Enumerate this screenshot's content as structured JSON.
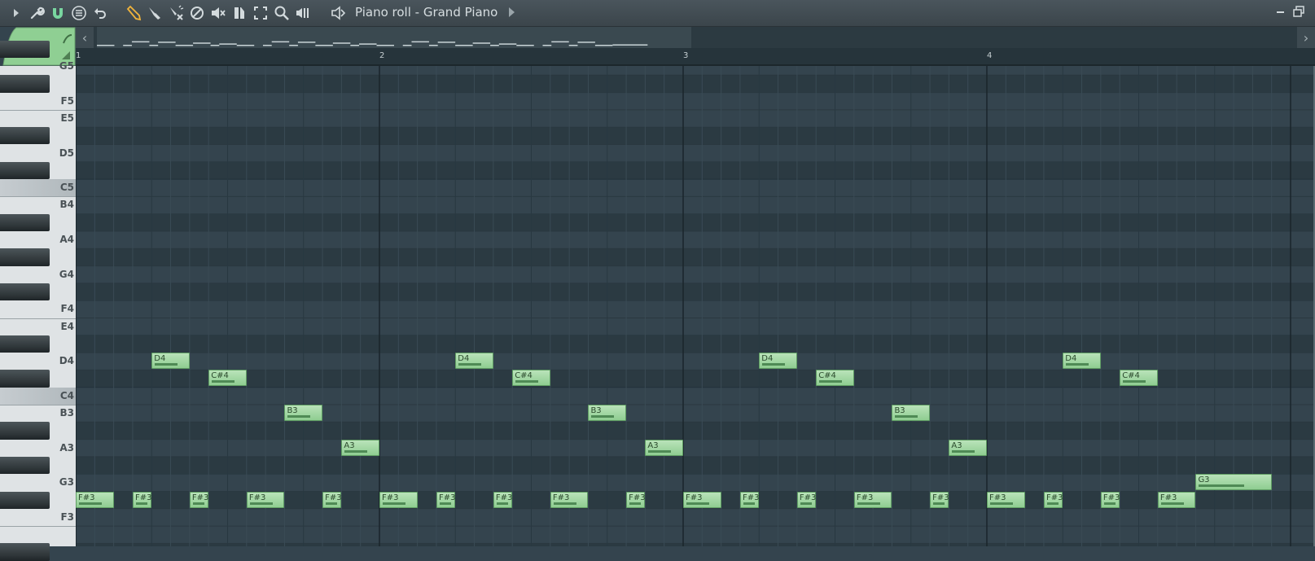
{
  "window": {
    "title": "Piano roll - Grand Piano"
  },
  "toolbar": {
    "icons": [
      "play-arrow-icon",
      "wrench-icon",
      "magnet-icon",
      "menu-circle-icon",
      "undo-icon",
      "pencil-icon",
      "paint-brush-icon",
      "delete-brush-icon",
      "mute-circle-icon",
      "mute-speaker-icon",
      "slice-icon",
      "select-icon",
      "zoom-icon",
      "playback-icon",
      "speaker-icon"
    ]
  },
  "ruler": {
    "bars": [
      "1",
      "2",
      "3",
      "4"
    ]
  },
  "keyboard": {
    "labels": [
      "G5",
      "F5",
      "E5",
      "D5",
      "C5",
      "B4",
      "A4",
      "G4",
      "F4",
      "E4",
      "D4",
      "C4",
      "B3",
      "A3",
      "G3",
      "F3"
    ]
  },
  "notes": [
    {
      "label": "F#3",
      "bar": 1.0,
      "len": 0.125,
      "pitch": "F#3"
    },
    {
      "label": "F#3",
      "bar": 1.1875,
      "len": 0.0625,
      "pitch": "F#3"
    },
    {
      "label": "D4",
      "bar": 1.25,
      "len": 0.125,
      "pitch": "D4"
    },
    {
      "label": "F#3",
      "bar": 1.375,
      "len": 0.0625,
      "pitch": "F#3"
    },
    {
      "label": "C#4",
      "bar": 1.4375,
      "len": 0.125,
      "pitch": "C#4"
    },
    {
      "label": "F#3",
      "bar": 1.5625,
      "len": 0.125,
      "pitch": "F#3"
    },
    {
      "label": "B3",
      "bar": 1.6875,
      "len": 0.125,
      "pitch": "B3"
    },
    {
      "label": "F#3",
      "bar": 1.8125,
      "len": 0.0625,
      "pitch": "F#3"
    },
    {
      "label": "A3",
      "bar": 1.875,
      "len": 0.125,
      "pitch": "A3"
    },
    {
      "label": "F#3",
      "bar": 2.0,
      "len": 0.125,
      "pitch": "F#3"
    },
    {
      "label": "F#3",
      "bar": 2.1875,
      "len": 0.0625,
      "pitch": "F#3"
    },
    {
      "label": "D4",
      "bar": 2.25,
      "len": 0.125,
      "pitch": "D4"
    },
    {
      "label": "F#3",
      "bar": 2.375,
      "len": 0.0625,
      "pitch": "F#3"
    },
    {
      "label": "C#4",
      "bar": 2.4375,
      "len": 0.125,
      "pitch": "C#4"
    },
    {
      "label": "F#3",
      "bar": 2.5625,
      "len": 0.125,
      "pitch": "F#3"
    },
    {
      "label": "B3",
      "bar": 2.6875,
      "len": 0.125,
      "pitch": "B3"
    },
    {
      "label": "F#3",
      "bar": 2.8125,
      "len": 0.0625,
      "pitch": "F#3"
    },
    {
      "label": "A3",
      "bar": 2.875,
      "len": 0.125,
      "pitch": "A3"
    },
    {
      "label": "F#3",
      "bar": 3.0,
      "len": 0.125,
      "pitch": "F#3"
    },
    {
      "label": "F#3",
      "bar": 3.1875,
      "len": 0.0625,
      "pitch": "F#3"
    },
    {
      "label": "D4",
      "bar": 3.25,
      "len": 0.125,
      "pitch": "D4"
    },
    {
      "label": "F#3",
      "bar": 3.375,
      "len": 0.0625,
      "pitch": "F#3"
    },
    {
      "label": "C#4",
      "bar": 3.4375,
      "len": 0.125,
      "pitch": "C#4"
    },
    {
      "label": "F#3",
      "bar": 3.5625,
      "len": 0.125,
      "pitch": "F#3"
    },
    {
      "label": "B3",
      "bar": 3.6875,
      "len": 0.125,
      "pitch": "B3"
    },
    {
      "label": "F#3",
      "bar": 3.8125,
      "len": 0.0625,
      "pitch": "F#3"
    },
    {
      "label": "A3",
      "bar": 3.875,
      "len": 0.125,
      "pitch": "A3"
    },
    {
      "label": "F#3",
      "bar": 4.0,
      "len": 0.125,
      "pitch": "F#3"
    },
    {
      "label": "F#3",
      "bar": 4.1875,
      "len": 0.0625,
      "pitch": "F#3"
    },
    {
      "label": "D4",
      "bar": 4.25,
      "len": 0.125,
      "pitch": "D4"
    },
    {
      "label": "F#3",
      "bar": 4.375,
      "len": 0.0625,
      "pitch": "F#3"
    },
    {
      "label": "C#4",
      "bar": 4.4375,
      "len": 0.125,
      "pitch": "C#4"
    },
    {
      "label": "F#3",
      "bar": 4.5625,
      "len": 0.125,
      "pitch": "F#3"
    },
    {
      "label": "G3",
      "bar": 4.6875,
      "len": 0.25,
      "pitch": "G3"
    }
  ],
  "colors": {
    "note_fill": "#a8dba9",
    "grid_bg": "#34444e",
    "accent": "#8fd19a"
  }
}
